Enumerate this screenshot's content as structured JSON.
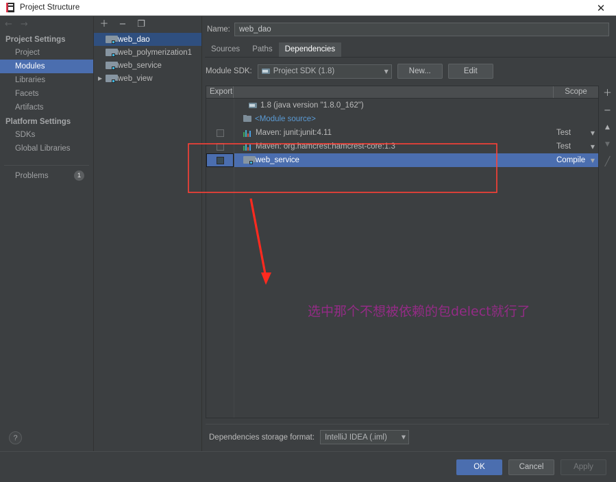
{
  "window": {
    "title": "Project Structure",
    "app_icon": "intellij-idea-icon",
    "close_label": "✕"
  },
  "sidebar": {
    "nav": {
      "back_icon": "←",
      "forward_icon": "→"
    },
    "groups": [
      {
        "heading": "Project Settings",
        "items": [
          {
            "label": "Project",
            "selected": false
          },
          {
            "label": "Modules",
            "selected": true
          },
          {
            "label": "Libraries",
            "selected": false
          },
          {
            "label": "Facets",
            "selected": false
          },
          {
            "label": "Artifacts",
            "selected": false
          }
        ]
      },
      {
        "heading": "Platform Settings",
        "items": [
          {
            "label": "SDKs",
            "selected": false
          },
          {
            "label": "Global Libraries",
            "selected": false
          }
        ]
      }
    ],
    "problems": {
      "label": "Problems",
      "count": "1"
    },
    "help": {
      "label": "?"
    }
  },
  "modules_panel": {
    "toolbar": [
      {
        "name": "add-module-button",
        "glyph": "＋"
      },
      {
        "name": "remove-module-button",
        "glyph": "−"
      },
      {
        "name": "copy-module-button",
        "glyph": "❐"
      }
    ],
    "items": [
      {
        "label": "web_dao",
        "selected": true,
        "expandable": false
      },
      {
        "label": "web_polymerization1",
        "selected": false,
        "expandable": false
      },
      {
        "label": "web_service",
        "selected": false,
        "expandable": false
      },
      {
        "label": "web_view",
        "selected": false,
        "expandable": true
      }
    ]
  },
  "main": {
    "name_field": {
      "label": "Name:",
      "value": "web_dao",
      "placeholder": "Module name"
    },
    "tabs": [
      {
        "label": "Sources",
        "active": false
      },
      {
        "label": "Paths",
        "active": false
      },
      {
        "label": "Dependencies",
        "active": true
      }
    ],
    "sdk_row": {
      "label": "Module SDK:",
      "value": "Project SDK (1.8)",
      "caret": "▼",
      "new_button": "New...",
      "edit_button": "Edit"
    },
    "table": {
      "headers": {
        "export": "Export",
        "scope": "Scope"
      },
      "rows": [
        {
          "name": "1.8 (java version \"1.8.0_162\")",
          "icon": "jdk-icon",
          "indent": 1,
          "checkbox": false,
          "has_checkbox": false,
          "scope": "",
          "has_scope": false,
          "selected": false
        },
        {
          "name": "<Module source>",
          "icon": "module-source-icon",
          "indent": 2,
          "checkbox": false,
          "has_checkbox": false,
          "scope": "",
          "has_scope": false,
          "selected": false
        },
        {
          "name": "Maven: junit:junit:4.11",
          "icon": "maven-icon",
          "indent": 2,
          "checkbox": false,
          "has_checkbox": true,
          "scope": "Test",
          "has_scope": true,
          "selected": false
        },
        {
          "name": "Maven: org.hamcrest:hamcrest-core:1.3",
          "icon": "maven-icon",
          "indent": 2,
          "checkbox": false,
          "has_checkbox": true,
          "scope": "Test",
          "has_scope": true,
          "selected": false
        },
        {
          "name": "web_service",
          "icon": "module-icon",
          "indent": 2,
          "checkbox": false,
          "has_checkbox": true,
          "scope": "Compile",
          "has_scope": true,
          "selected": true
        }
      ],
      "side_buttons": [
        {
          "name": "add-dependency-button",
          "glyph": "＋",
          "disabled": false
        },
        {
          "name": "remove-dependency-button",
          "glyph": "−",
          "disabled": false
        },
        {
          "name": "move-up-button",
          "glyph": "▲",
          "disabled": false
        },
        {
          "name": "move-down-button",
          "glyph": "▼",
          "disabled": true
        },
        {
          "name": "edit-dependency-button",
          "glyph": "╱",
          "disabled": true
        }
      ]
    },
    "storage": {
      "label": "Dependencies storage format:",
      "value": "IntelliJ IDEA (.iml)",
      "caret": "▼"
    }
  },
  "footer": {
    "ok": "OK",
    "cancel": "Cancel",
    "apply": "Apply"
  },
  "annotations": {
    "note_text": "选中那个不想被依赖的包delect就行了",
    "note_color": "#9c2a8c",
    "highlight_color": "#ff4136",
    "arrow_color": "#ff2a1f"
  }
}
